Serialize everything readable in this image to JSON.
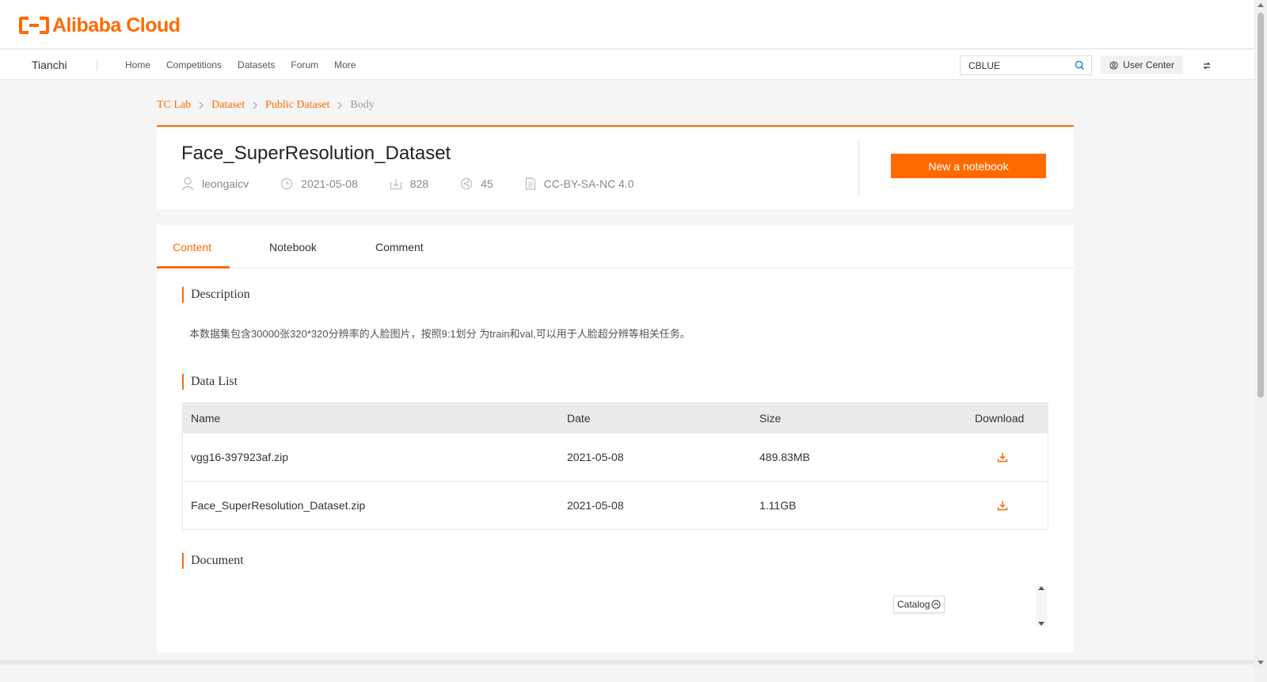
{
  "brand": {
    "logo_text": "Alibaba Cloud"
  },
  "nav": {
    "brand": "Tianchi",
    "links": [
      "Home",
      "Competitions",
      "Datasets",
      "Forum",
      "More"
    ],
    "search_value": "CBLUE",
    "user_center": "User Center"
  },
  "breadcrumb": [
    "TC Lab",
    "Dataset",
    "Public Dataset",
    "Body"
  ],
  "dataset": {
    "title": "Face_SuperResolution_Dataset",
    "author": "leongaicv",
    "date": "2021-05-08",
    "downloads": "828",
    "shares": "45",
    "license": "CC-BY-SA-NC 4.0",
    "new_notebook": "New a notebook"
  },
  "tabs": [
    "Content",
    "Notebook",
    "Comment"
  ],
  "sections": {
    "description_title": "Description",
    "description_text": "本数据集包含30000张320*320分辨率的人脸图片，按照9:1划分 为train和val,可以用于人脸超分辨等相关任务。",
    "data_list_title": "Data List",
    "document_title": "Document"
  },
  "table": {
    "headers": [
      "Name",
      "Date",
      "Size",
      "Download"
    ],
    "rows": [
      {
        "name": "vgg16-397923af.zip",
        "date": "2021-05-08",
        "size": "489.83MB"
      },
      {
        "name": "Face_SuperResolution_Dataset.zip",
        "date": "2021-05-08",
        "size": "1.11GB"
      }
    ]
  },
  "catalog_label": "Catalog",
  "colors": {
    "accent": "#ff6a00"
  }
}
